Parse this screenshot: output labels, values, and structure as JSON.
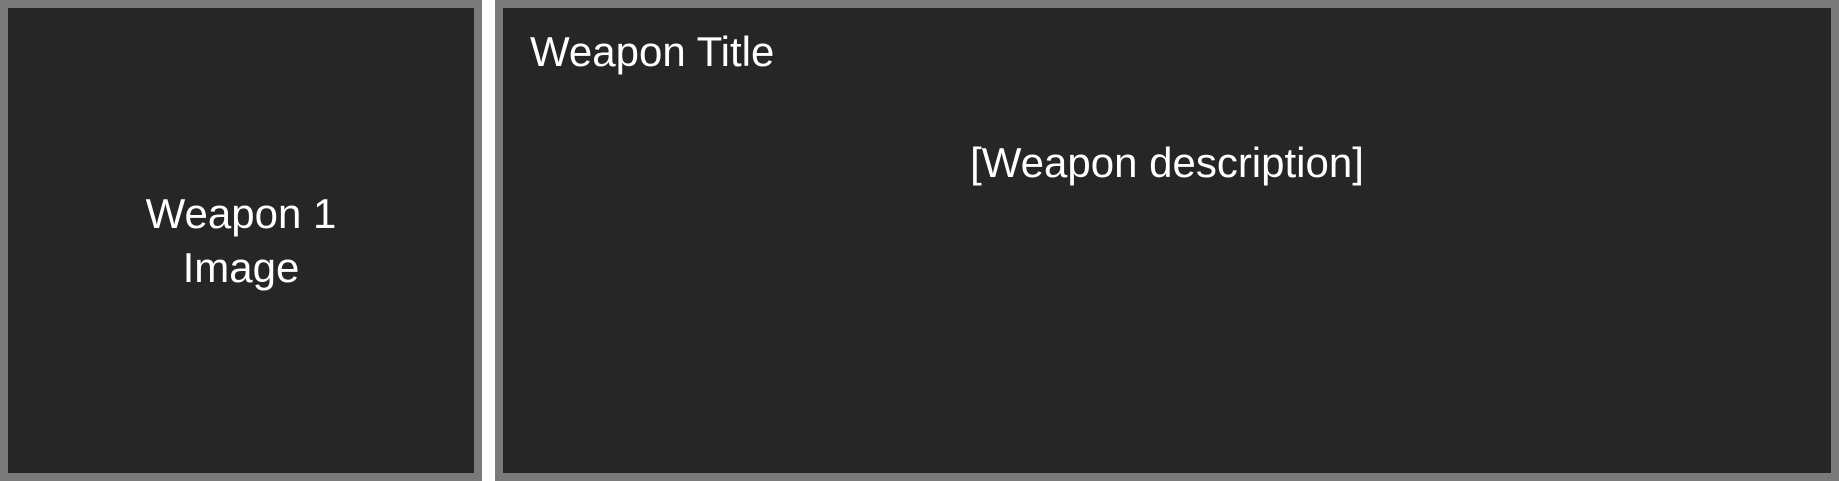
{
  "image_panel": {
    "line1": "Weapon 1",
    "line2": "Image"
  },
  "info_panel": {
    "title": "Weapon Title",
    "description": "[Weapon description]"
  },
  "colors": {
    "panel_background": "#262626",
    "panel_border": "#7a7a7a",
    "text": "#ffffff"
  }
}
